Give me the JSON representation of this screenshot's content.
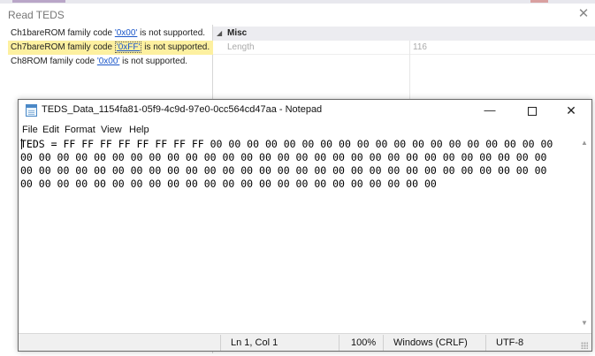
{
  "dialog": {
    "title": "Read TEDS",
    "close_glyph": "✕",
    "messages": [
      {
        "before": "Ch1bareROM family code ",
        "code": "'0x00'",
        "after": " is not supported.",
        "selected": false
      },
      {
        "before": "Ch7bareROM family code ",
        "code": "'0xFF'",
        "after": " is not supported.",
        "selected": true
      },
      {
        "before": "Ch8ROM family code ",
        "code": "'0x00'",
        "after": " is not supported.",
        "selected": false
      }
    ],
    "properties": {
      "category": "Misc",
      "rows": [
        {
          "name": "Length",
          "value": "116"
        }
      ]
    }
  },
  "notepad": {
    "title": "TEDS_Data_1154fa81-05f9-4c9d-97e0-0cc564cd47aa - Notepad",
    "minimize_glyph": "—",
    "close_glyph": "✕",
    "menus": [
      "File",
      "Edit",
      "Format",
      "View",
      "Help"
    ],
    "content_lines": [
      "TEDS = FF FF FF FF FF FF FF FF 00 00 00 00 00 00 00 00 00 00 00 00 00 00 00 00 00 00 00",
      "00 00 00 00 00 00 00 00 00 00 00 00 00 00 00 00 00 00 00 00 00 00 00 00 00 00 00 00 00",
      "00 00 00 00 00 00 00 00 00 00 00 00 00 00 00 00 00 00 00 00 00 00 00 00 00 00 00 00 00",
      "00 00 00 00 00 00 00 00 00 00 00 00 00 00 00 00 00 00 00 00 00 00 00"
    ],
    "status": {
      "position": "Ln 1, Col 1",
      "zoom": "100%",
      "line_endings": "Windows (CRLF)",
      "encoding": "UTF-8"
    }
  }
}
